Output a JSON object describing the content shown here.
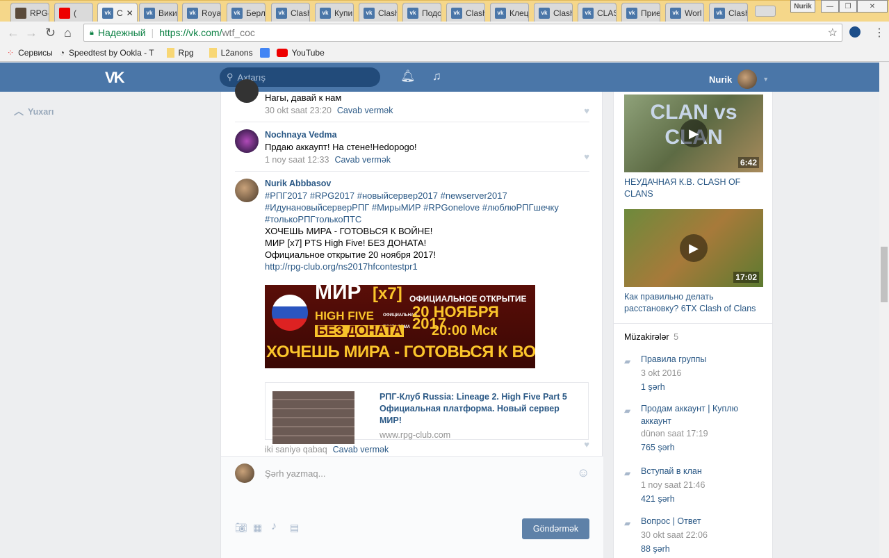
{
  "browser": {
    "tabs": [
      "RPG-",
      "(",
      "С",
      "Вики",
      "Roya",
      "Берл",
      "Clash",
      "Купи",
      "Clash",
      "Подс",
      "Clash",
      "Клец",
      "Clash",
      "CLAS",
      "Прие",
      "Worl",
      "Clash"
    ],
    "profile": "Nurik",
    "secure_label": "Надежный",
    "url_host": "https://vk.com/",
    "url_path": "wtf_coc",
    "bookmarks": [
      "Сервисы",
      "Speedtest by Ookla - T",
      "Rpg",
      "L2anons",
      "YouTube"
    ]
  },
  "header": {
    "search_placeholder": "Axtarış",
    "user": "Nurik"
  },
  "left": {
    "up_label": "Yuxarı"
  },
  "comments": [
    {
      "name": "",
      "text": "Нагы, давай к нам",
      "time": "30 okt saat 23:20",
      "reply": "Cavab vermək"
    },
    {
      "name": "Nochnaya Vedma",
      "text": "Прдаю аккаупт! На стене!Hedopogo!",
      "time": "1 noy saat 12:33",
      "reply": "Cavab vermək"
    },
    {
      "name": "Nurik Abbbasov",
      "tags1": "#РПГ2017 #RPG2017 #новыйсервер2017 #newserver2017",
      "tags2": "#ИдунановыйсерверРПГ #МирыМИР #RPGonelove #люблюРПГшечку",
      "tags3": "#толькоРПГтолькоПТС",
      "line1": "ХОЧЕШЬ МИРА - ГОТОВЬСЯ К ВОЙНЕ!",
      "line2": "МИР [x7] PTS High Five! БЕЗ ДОНАТА!",
      "line3": "Официальное открытие 20 ноября 2017!",
      "link": "http://rpg-club.org/ns2017hfcontestpr1",
      "banner": {
        "mir": "МИР",
        "x7": "[x7]",
        "hf": "HIGH FIVE",
        "plat": "ОФИЦИАЛЬНАЯ ПЛАТФОРМА",
        "nodon": "БЕЗ ДОНАТА",
        "open": "ОФИЦИАЛЬНОЕ ОТКРЫТИЕ",
        "date": "20 НОЯБРЯ 2017",
        "time": "20:00 Мск",
        "slogan": "ХОЧЕШЬ МИРА - ГОТОВЬСЯ К ВОЙНЕ"
      },
      "card_title": "РПГ-Клуб Russia: Lineage 2. High Five Part 5 Официальная платформа. Новый сервер МИР!",
      "card_domain": "www.rpg-club.com",
      "time": "iki saniyə qabaq",
      "reply": "Cavab vermək"
    }
  ],
  "compose": {
    "placeholder": "Şərh yazmaq...",
    "send": "Göndərmək"
  },
  "videos": [
    {
      "title": "НЕУДАЧНАЯ К.В. CLASH OF CLANS",
      "duration": "6:42",
      "thumb": "CLAN vs CLAN"
    },
    {
      "title": "Как правильно делать расстановку? 6ТХ Clash of Clans",
      "duration": "17:02"
    }
  ],
  "discussions": {
    "title": "Müzakirələr",
    "count": "5",
    "items": [
      {
        "title": "Правила группы",
        "date": "3 okt 2016",
        "comments": "1 şərh"
      },
      {
        "title": "Продам аккаунт | Куплю аккаунт",
        "date": "dünən saat 17:19",
        "comments": "765 şərh"
      },
      {
        "title": "Вступай в клан",
        "date": "1 noy saat 21:46",
        "comments": "421 şərh"
      },
      {
        "title": "Вопрос | Ответ",
        "date": "30 okt saat 22:06",
        "comments": "88 şərh"
      }
    ]
  }
}
